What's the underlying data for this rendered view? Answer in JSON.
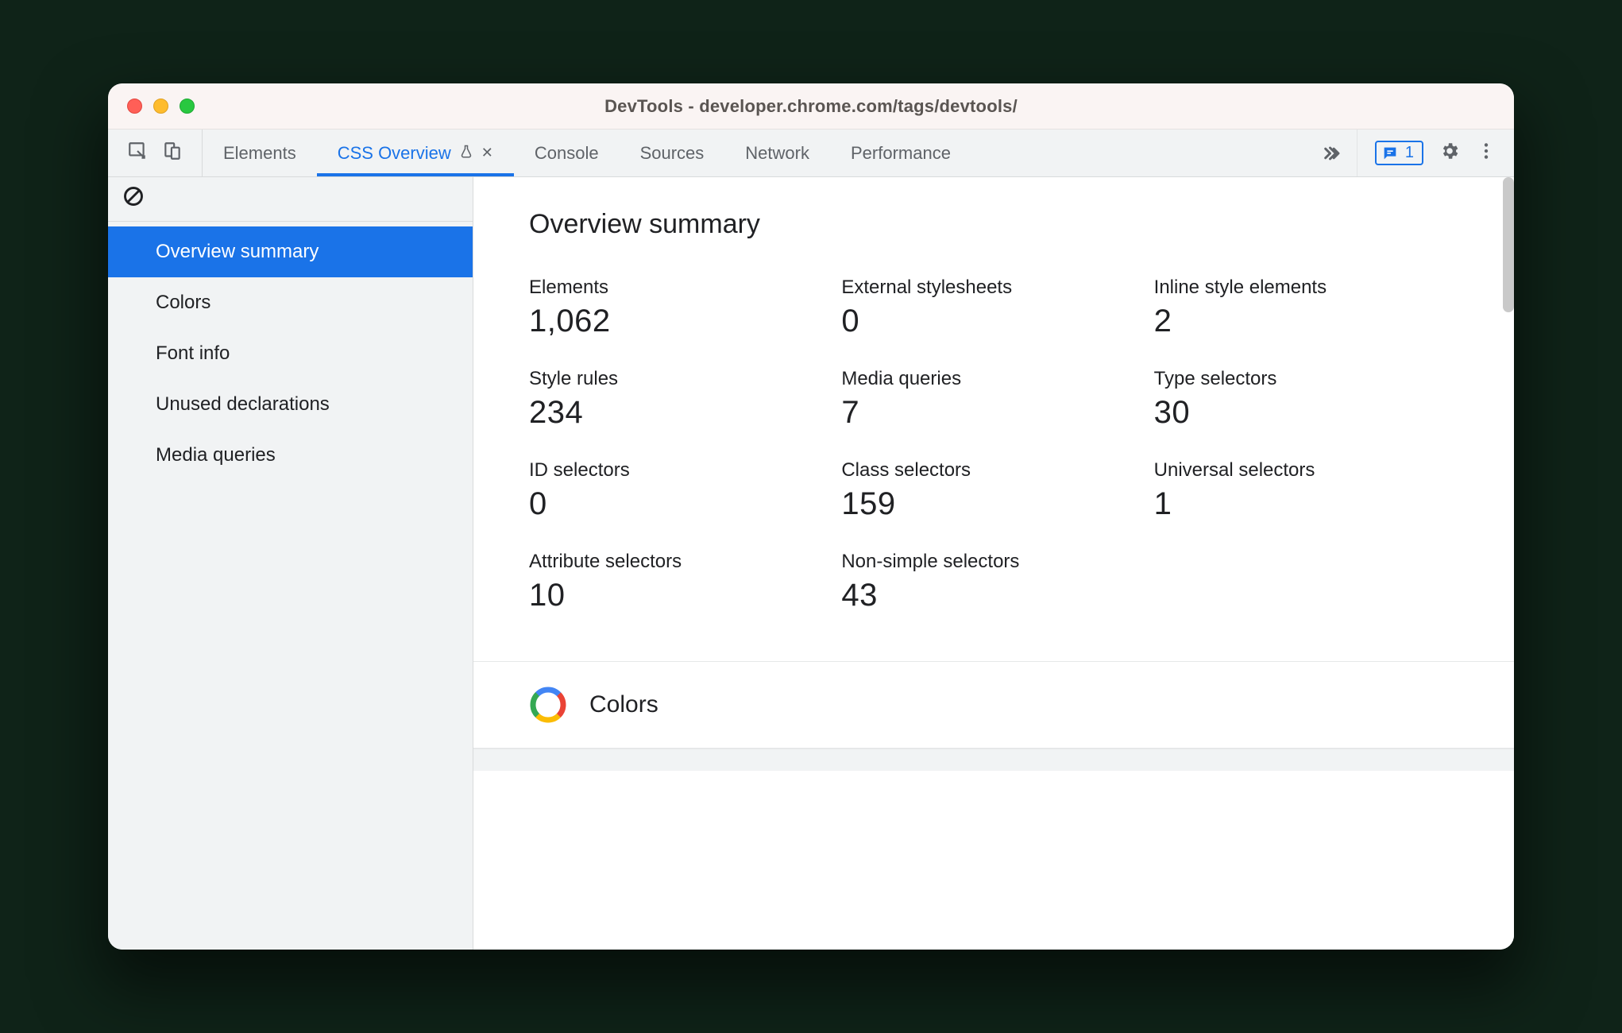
{
  "window": {
    "title": "DevTools - developer.chrome.com/tags/devtools/"
  },
  "devtools_tabs": {
    "items": [
      {
        "label": "Elements"
      },
      {
        "label": "CSS Overview",
        "experimental": true,
        "closable": true,
        "active": true
      },
      {
        "label": "Console"
      },
      {
        "label": "Sources"
      },
      {
        "label": "Network"
      },
      {
        "label": "Performance"
      }
    ],
    "issues_count": "1"
  },
  "sidebar": {
    "items": [
      {
        "label": "Overview summary",
        "active": true
      },
      {
        "label": "Colors"
      },
      {
        "label": "Font info"
      },
      {
        "label": "Unused declarations"
      },
      {
        "label": "Media queries"
      }
    ]
  },
  "overview": {
    "heading": "Overview summary",
    "stats": [
      {
        "label": "Elements",
        "value": "1,062"
      },
      {
        "label": "External stylesheets",
        "value": "0"
      },
      {
        "label": "Inline style elements",
        "value": "2"
      },
      {
        "label": "Style rules",
        "value": "234"
      },
      {
        "label": "Media queries",
        "value": "7"
      },
      {
        "label": "Type selectors",
        "value": "30"
      },
      {
        "label": "ID selectors",
        "value": "0"
      },
      {
        "label": "Class selectors",
        "value": "159"
      },
      {
        "label": "Universal selectors",
        "value": "1"
      },
      {
        "label": "Attribute selectors",
        "value": "10"
      },
      {
        "label": "Non-simple selectors",
        "value": "43"
      }
    ]
  },
  "colors_section": {
    "title": "Colors"
  }
}
